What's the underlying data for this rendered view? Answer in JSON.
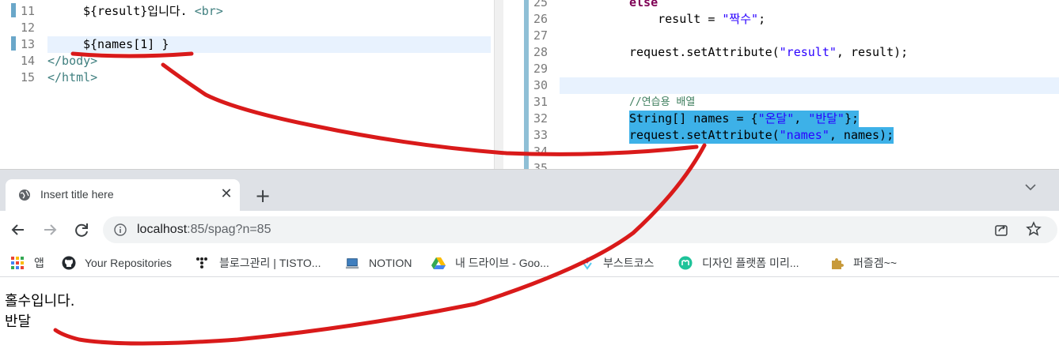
{
  "left_editor": {
    "lines": [
      {
        "num": "11",
        "indent": "    ",
        "segments": [
          {
            "t": "${result}입니다. ",
            "c": "el"
          },
          {
            "t": "<br>",
            "c": "tag"
          }
        ]
      },
      {
        "num": "12",
        "indent": "",
        "segments": []
      },
      {
        "num": "13",
        "indent": "    ",
        "segments": [
          {
            "t": "${names[1]",
            "c": "el"
          },
          {
            "t": " }",
            "c": "el"
          }
        ]
      },
      {
        "num": "14",
        "indent": "",
        "segments": [
          {
            "t": "</body>",
            "c": "tag"
          }
        ]
      },
      {
        "num": "15",
        "indent": "",
        "segments": [
          {
            "t": "</html>",
            "c": "tag"
          }
        ]
      }
    ]
  },
  "right_editor": {
    "lines": [
      {
        "num": "25",
        "code": "else",
        "cls": "kw"
      },
      {
        "num": "26",
        "prefix": "    result = ",
        "str": "\"짝수\"",
        "suffix": ";"
      },
      {
        "num": "27",
        "code": ""
      },
      {
        "num": "28",
        "prefix": "request.setAttribute(",
        "str": "\"result\"",
        "suffix": ", result);"
      },
      {
        "num": "29",
        "code": ""
      },
      {
        "num": "30",
        "code": ""
      },
      {
        "num": "31",
        "comment": "//연습용 배열"
      },
      {
        "num": "32",
        "prefix": "String[] names = {",
        "str": "\"온달\"",
        "mid": ", ",
        "str2": "\"반달\"",
        "suffix": "};"
      },
      {
        "num": "33",
        "prefix": "request.setAttribute(",
        "str": "\"names\"",
        "suffix": ", names);"
      },
      {
        "num": "34",
        "code": ""
      },
      {
        "num": "35",
        "code": ""
      }
    ]
  },
  "browser": {
    "tab_title": "Insert title here",
    "tab_close_glyph": "✕",
    "new_tab_glyph": "+",
    "url_host": "localhost",
    "url_path": ":85/spag?n=85",
    "bookmarks": [
      {
        "label": "앱",
        "icon": "apps-grid-icon"
      },
      {
        "label": "Your Repositories",
        "icon": "github-icon"
      },
      {
        "label": "블로그관리 | TISTO...",
        "icon": "tistory-icon"
      },
      {
        "label": "NOTION",
        "icon": "laptop-icon"
      },
      {
        "label": "내 드라이브 - Goo...",
        "icon": "google-drive-icon"
      },
      {
        "label": "부스트코스",
        "icon": "boostcourse-icon"
      },
      {
        "label": "디자인 플랫폼 미리...",
        "icon": "miricanvas-icon"
      },
      {
        "label": "퍼즐겜~~",
        "icon": "puzzle-icon"
      }
    ]
  },
  "page_content": {
    "line1": "홀수입니다.",
    "line2": "반달"
  },
  "colors": {
    "annotation": "#d91a1a",
    "selection": "#3db1e8",
    "current_line": "#e8f2fe"
  }
}
